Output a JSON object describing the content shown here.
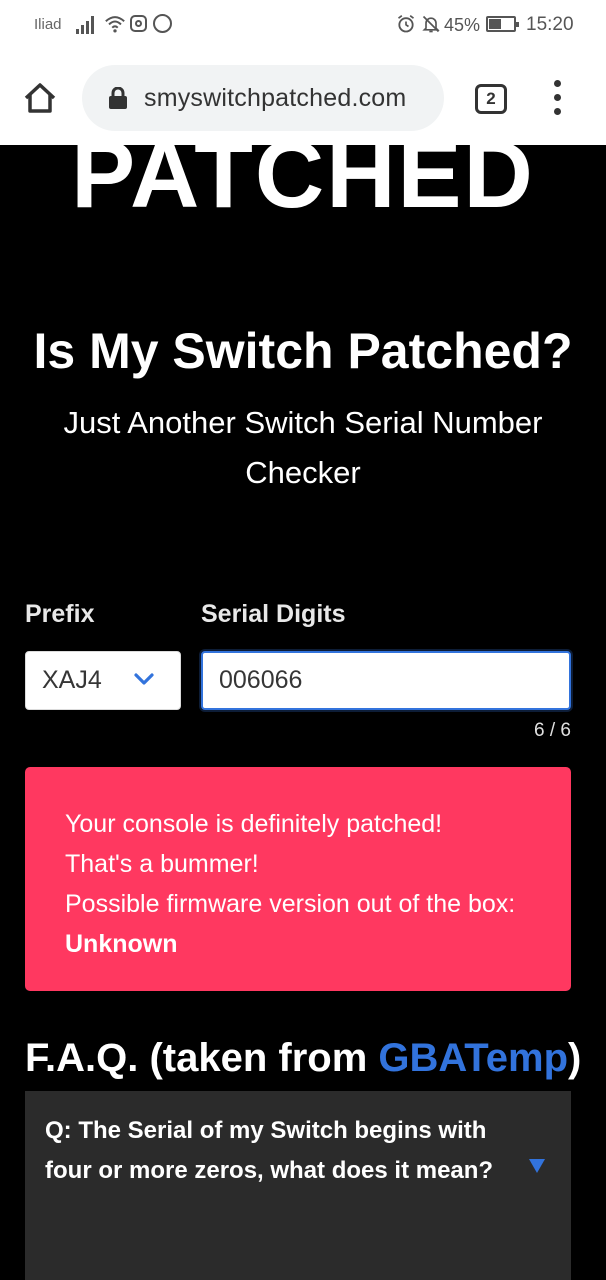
{
  "status_bar": {
    "carrier": "Iliad",
    "battery_percent": "45%",
    "time": "15:20"
  },
  "browser": {
    "url": "smyswitchpatched.com",
    "tab_count": "2"
  },
  "page": {
    "logo_text": "PATCHED",
    "title": "Is My Switch Patched?",
    "subtitle": "Just Another Switch Serial Number Checker",
    "form": {
      "prefix_label": "Prefix",
      "serial_label": "Serial Digits",
      "prefix_value": "XAJ4",
      "serial_value": "006066",
      "counter": "6 / 6"
    },
    "result": {
      "line1": "Your console is definitely patched!",
      "line2": "That's a bummer!",
      "line3_prefix": "Possible firmware version out of the box:",
      "line3_value": "Unknown",
      "color": "#ff3860"
    },
    "faq": {
      "title_prefix": "F.A.Q. (taken from",
      "title_link": "GBATemp",
      "title_suffix": ")",
      "question1": "Q: The Serial of my Switch begins with four or more zeros, what does it mean?"
    }
  },
  "colors": {
    "accent": "#3273dc",
    "danger": "#ff3860",
    "background": "#000000"
  }
}
